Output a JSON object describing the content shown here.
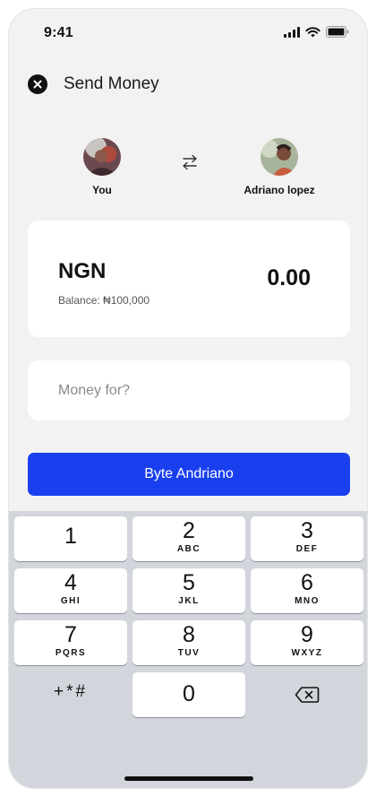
{
  "status_bar": {
    "time": "9:41"
  },
  "header": {
    "title": "Send Money"
  },
  "sender": {
    "name": "You"
  },
  "recipient": {
    "name": "Adriano lopez"
  },
  "amount_card": {
    "currency": "NGN",
    "balance": "Balance: ₦100,000",
    "amount": "0.00"
  },
  "note": {
    "placeholder": "Money for?"
  },
  "primary_button": {
    "label": "Byte Andriano"
  },
  "colors": {
    "accent": "#1A3FEF",
    "background": "#F2F2F2",
    "keypad": "#D2D5DB"
  },
  "keypad": {
    "keys": [
      {
        "num": "1",
        "letters": ""
      },
      {
        "num": "2",
        "letters": "ABC"
      },
      {
        "num": "3",
        "letters": "DEF"
      },
      {
        "num": "4",
        "letters": "GHI"
      },
      {
        "num": "5",
        "letters": "JKL"
      },
      {
        "num": "6",
        "letters": "MNO"
      },
      {
        "num": "7",
        "letters": "PQRS"
      },
      {
        "num": "8",
        "letters": "TUV"
      },
      {
        "num": "9",
        "letters": "WXYZ"
      }
    ],
    "symbols": "+*#",
    "zero": "0",
    "delete_icon": "backspace-icon"
  }
}
